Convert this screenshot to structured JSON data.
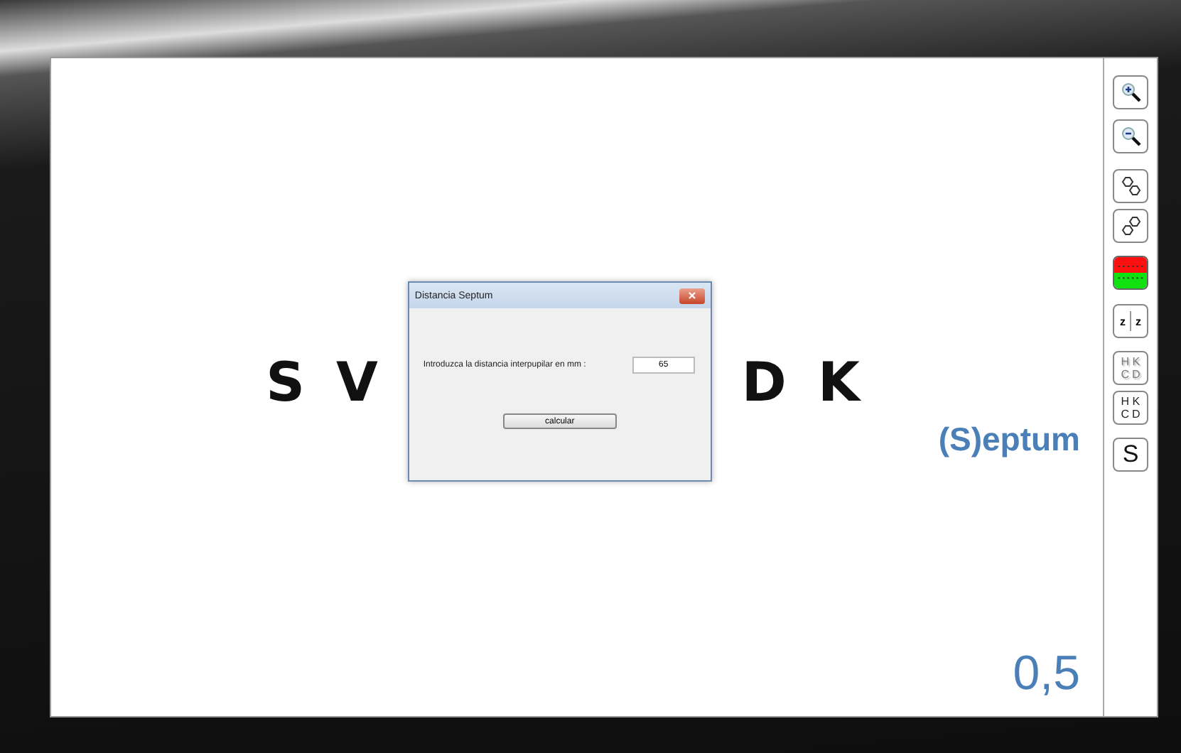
{
  "chart": {
    "left_letters": [
      "S",
      "V"
    ],
    "right_letters": [
      "D",
      "K"
    ]
  },
  "dialog": {
    "title": "Distancia Septum",
    "label": "Introduzca la distancia interpupilar en mm :",
    "value": "65",
    "button": "calcular"
  },
  "test_name": "(S)eptum",
  "acuity": "0,5",
  "toolbar": [
    {
      "kind": "zoom-in"
    },
    {
      "kind": "zoom-out"
    },
    {
      "kind": "rotate-left"
    },
    {
      "kind": "rotate-right"
    },
    {
      "kind": "red-green"
    },
    {
      "kind": "split",
      "letters": [
        "z",
        "z"
      ]
    },
    {
      "kind": "letters",
      "letters": [
        "H",
        "K",
        "C",
        "D"
      ],
      "blurred": true
    },
    {
      "kind": "letters",
      "letters": [
        "H",
        "K",
        "C",
        "D"
      ],
      "blurred": false
    },
    {
      "kind": "text",
      "letters": [
        "S"
      ]
    }
  ]
}
